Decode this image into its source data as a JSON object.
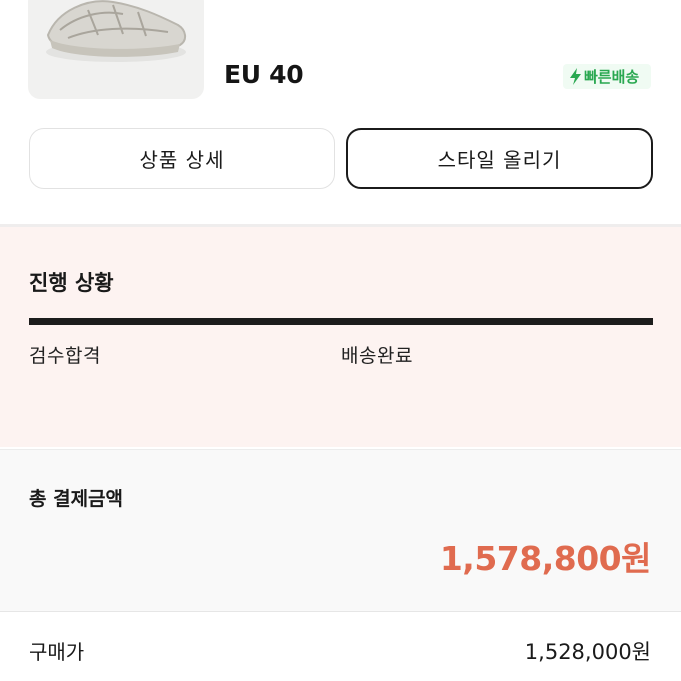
{
  "product": {
    "size": "EU 40",
    "fast_delivery_label": "빠른배송"
  },
  "actions": {
    "detail_label": "상품 상세",
    "style_label": "스타일 올리기"
  },
  "progress": {
    "title": "진행 상황",
    "steps": [
      "검수합격",
      "배송완료"
    ],
    "completed_fraction": 1.0
  },
  "payment": {
    "total_label": "총 결제금액",
    "total_amount": "1,578,800원",
    "purchase_label": "구매가",
    "purchase_amount": "1,528,000원"
  },
  "icons": {
    "fast_delivery": "lightning-bolt-icon"
  },
  "colors": {
    "accent_price": "#e06b4f",
    "fast_delivery_green": "#2aa851",
    "progress_background": "#fdf3f1"
  }
}
